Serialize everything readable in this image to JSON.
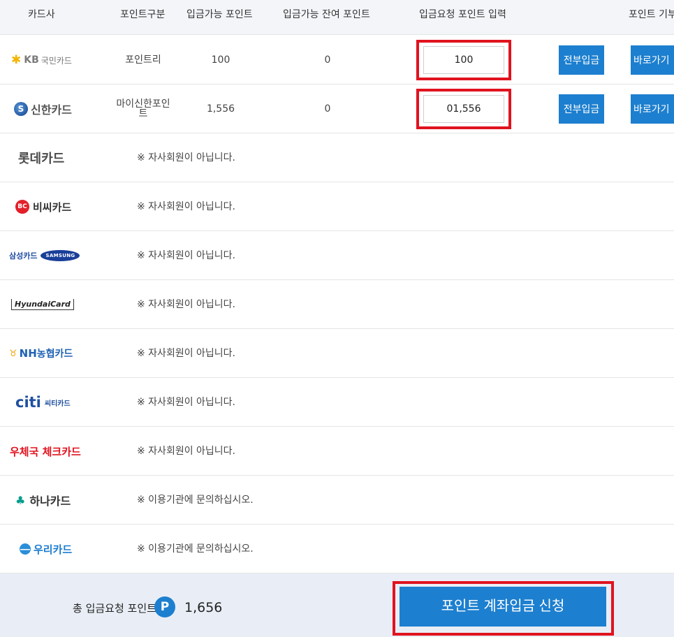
{
  "header": {
    "card_company": "카드사",
    "point_type": "포인트구분",
    "available_points": "입금가능 포인트",
    "remaining_points": "입금가능 잔여 포인트",
    "request_input": "입금요청 포인트 입력",
    "donate": "포인트 기부"
  },
  "rows": [
    {
      "logo_text": "KB",
      "logo_sub": "국민카드",
      "point_type": "포인트리",
      "available": "100",
      "remaining": "0",
      "input_value": "100",
      "all_button": "전부입금",
      "go_button": "바로가기"
    },
    {
      "logo_text": "신한카드",
      "point_type": "마이신한포인트",
      "available": "1,556",
      "remaining": "0",
      "input_value": "01,556",
      "all_button": "전부입금",
      "go_button": "바로가기"
    }
  ],
  "other_cards": [
    {
      "logo": "롯데카드",
      "message": "※ 자사회원이 아닙니다."
    },
    {
      "logo": "비씨카드",
      "message": "※ 자사회원이 아닙니다."
    },
    {
      "logo": "삼성카드",
      "logo_sub": "SAMSUNG",
      "message": "※ 자사회원이 아닙니다."
    },
    {
      "logo": "HyundaiCard",
      "message": "※ 자사회원이 아닙니다."
    },
    {
      "logo": "NH",
      "logo_sub": "농협카드",
      "message": "※ 자사회원이 아닙니다."
    },
    {
      "logo": "citi",
      "logo_sub": "씨티카드",
      "message": "※ 자사회원이 아닙니다."
    },
    {
      "logo": "우체국 체크카드",
      "message": "※ 자사회원이 아닙니다."
    },
    {
      "logo": "하나카드",
      "message": "※ 이용기관에 문의하십시오."
    },
    {
      "logo": "우리카드",
      "message": "※ 이용기관에 문의하십시오."
    }
  ],
  "footer": {
    "total_label": "총 입금요청 포인트",
    "badge": "P",
    "total_value": "1,656",
    "submit_label": "포인트 계좌입금 신청"
  },
  "colors": {
    "accent": "#1d7fcf",
    "highlight": "#e0131f",
    "header_bg": "#f3f5f8",
    "footer_bg": "#e9eef6"
  }
}
